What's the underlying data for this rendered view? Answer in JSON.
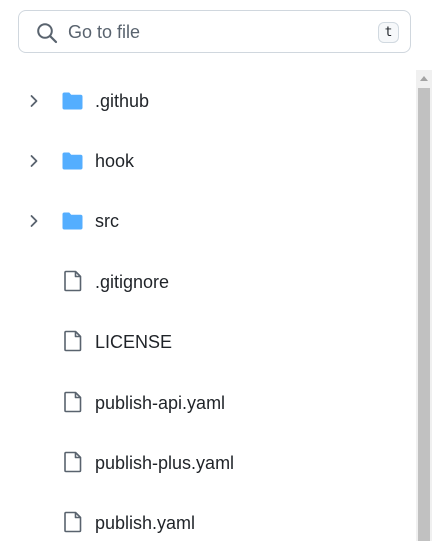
{
  "search": {
    "placeholder": "Go to file",
    "shortcut": "t"
  },
  "tree": {
    "items": [
      {
        "label": ".github",
        "type": "folder",
        "expanded": false
      },
      {
        "label": "hook",
        "type": "folder",
        "expanded": false
      },
      {
        "label": "src",
        "type": "folder",
        "expanded": false
      },
      {
        "label": ".gitignore",
        "type": "file"
      },
      {
        "label": "LICENSE",
        "type": "file"
      },
      {
        "label": "publish-api.yaml",
        "type": "file"
      },
      {
        "label": "publish-plus.yaml",
        "type": "file"
      },
      {
        "label": "publish.yaml",
        "type": "file"
      }
    ]
  },
  "colors": {
    "folder": "#54aeff",
    "icon_gray": "#59636e",
    "text": "#1f2328",
    "border": "#d0d7de"
  }
}
